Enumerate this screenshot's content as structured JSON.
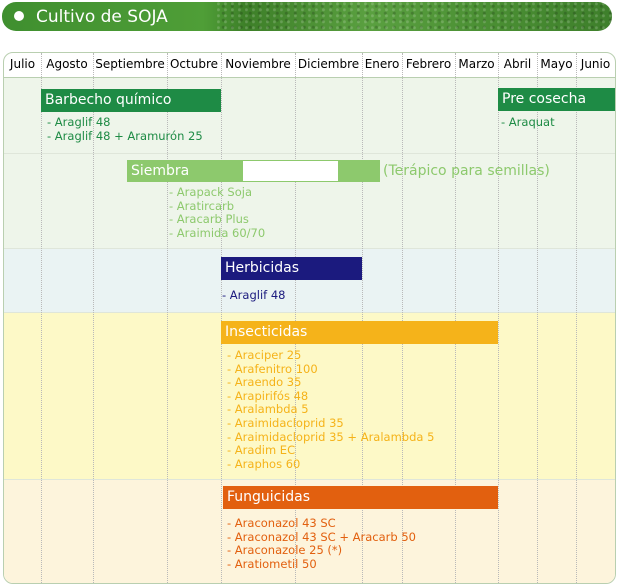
{
  "header": {
    "title": "Cultivo de SOJA"
  },
  "months": [
    "Julio",
    "Agosto",
    "Septiembre",
    "Octubre",
    "Noviembre",
    "Diciembre",
    "Enero",
    "Febrero",
    "Marzo",
    "Abril",
    "Mayo",
    "Junio"
  ],
  "colors": {
    "green_dark": "#1e8b45",
    "green_light": "#8dc96d",
    "navy": "#1b1a7e",
    "amber": "#f5b31a",
    "orange": "#e2600f",
    "band_green": "#eef5ea",
    "band_blue": "#eaf3f3",
    "band_yellow": "#fdf9c7",
    "band_cream": "#fdf4dc"
  },
  "sections": {
    "barbecho": {
      "label": "Barbecho químico",
      "items": [
        "- Araglif 48",
        "- Araglif 48 + Aramurón 25"
      ]
    },
    "precosecha": {
      "label": "Pre cosecha",
      "items": [
        "- Araquat"
      ]
    },
    "siembra": {
      "label": "Siembra",
      "note": "(Terápico para semillas)",
      "items": [
        "- Arapack Soja",
        "- Aratircarb",
        "- Aracarb Plus",
        "- Araimida 60/70"
      ]
    },
    "herbicidas": {
      "label": "Herbicidas",
      "items": [
        "- Araglif 48"
      ]
    },
    "insecticidas": {
      "label": "Insecticidas",
      "items": [
        "- Araciper 25",
        "- Arafenitro 100",
        "- Araendo 35",
        "- Arapirifós 48",
        "- Aralambda 5",
        "- Araimidacloprid  35",
        "- Araimidacloprid 35 + Aralambda 5",
        "- Aradim EC",
        "- Araphos 60"
      ]
    },
    "funguicidas": {
      "label": "Funguicidas",
      "items": [
        "- Araconazol 43 SC",
        "- Araconazol 43 SC + Aracarb 50",
        "- Araconazole 25 (*)",
        "- Aratiometil 50"
      ]
    }
  }
}
